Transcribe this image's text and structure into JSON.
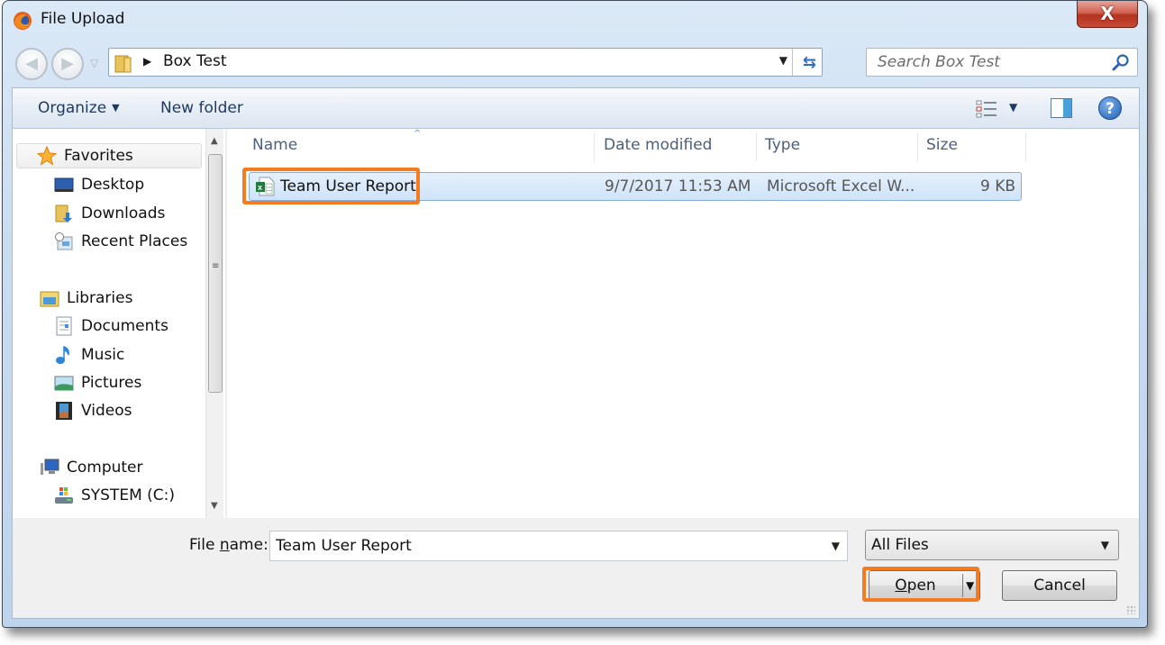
{
  "window": {
    "title": "File Upload",
    "app_icon": "firefox-icon",
    "close_label": "X"
  },
  "navigation": {
    "back_icon": "back-arrow-icon",
    "forward_icon": "forward-arrow-icon",
    "recent_icon": "chevron-down-icon",
    "address": {
      "folder_icon": "folder-icon",
      "separator": "▶",
      "path": "Box Test",
      "dropdown_icon": "▼",
      "refresh_icon": "refresh-icon"
    },
    "search": {
      "placeholder": "Search Box Test",
      "icon": "search-icon"
    }
  },
  "toolbar": {
    "organize_label": "Organize",
    "organize_caret": "▼",
    "new_folder_label": "New folder",
    "views_caret": "▼",
    "help_label": "?"
  },
  "sidebar": {
    "groups": [
      {
        "label": "Favorites",
        "icon": "star-icon",
        "items": [
          {
            "label": "Desktop",
            "icon": "desktop-icon"
          },
          {
            "label": "Downloads",
            "icon": "downloads-icon"
          },
          {
            "label": "Recent Places",
            "icon": "recent-places-icon"
          }
        ]
      },
      {
        "label": "Libraries",
        "icon": "libraries-icon",
        "items": [
          {
            "label": "Documents",
            "icon": "documents-icon"
          },
          {
            "label": "Music",
            "icon": "music-icon"
          },
          {
            "label": "Pictures",
            "icon": "pictures-icon"
          },
          {
            "label": "Videos",
            "icon": "videos-icon"
          }
        ]
      },
      {
        "label": "Computer",
        "icon": "computer-icon",
        "items": [
          {
            "label": "SYSTEM (C:)",
            "icon": "drive-icon"
          }
        ]
      }
    ],
    "scroll_up": "▲",
    "scroll_down": "▼",
    "scroll_grip": "≡"
  },
  "file_list": {
    "columns": [
      "Name",
      "Date modified",
      "Type",
      "Size"
    ],
    "sort_indicator": "^",
    "rows": [
      {
        "name": "Team User Report",
        "date_modified": "9/7/2017 11:53 AM",
        "type": "Microsoft Excel W...",
        "size": "9 KB",
        "icon": "excel-file-icon",
        "selected": true
      }
    ]
  },
  "footer": {
    "file_name_label_pre": "File ",
    "file_name_label_mnemonic": "n",
    "file_name_label_post": "ame:",
    "file_name_value": "Team User Report",
    "file_name_dropdown": "▼",
    "file_type_value": "All Files",
    "file_type_dropdown": "▼",
    "open_mnemonic": "O",
    "open_rest": "pen",
    "open_split_arrow": "▼",
    "cancel_label": "Cancel"
  },
  "annotations": {
    "highlight_color": "#f47b20"
  }
}
